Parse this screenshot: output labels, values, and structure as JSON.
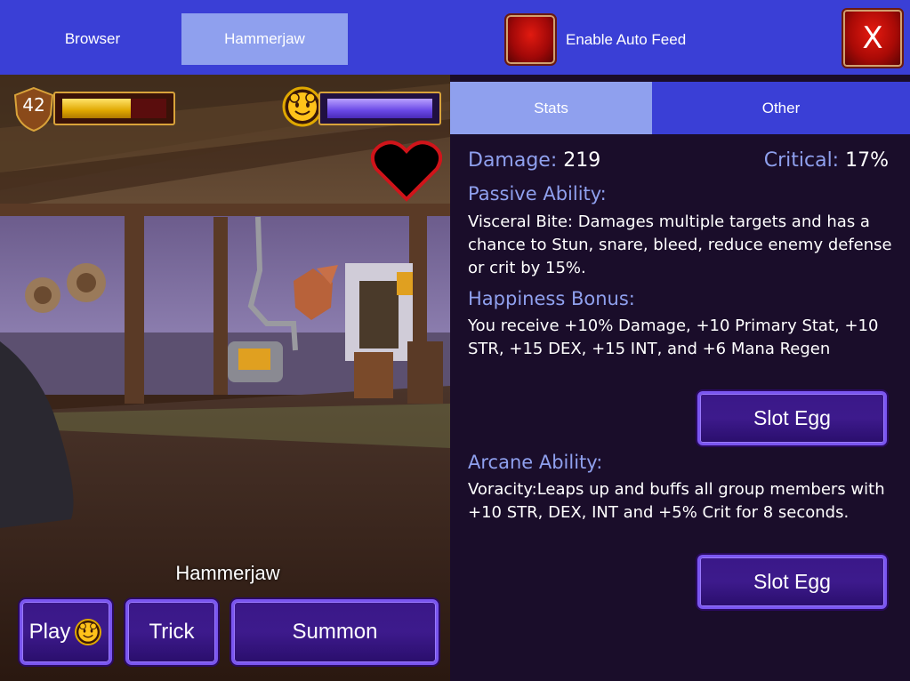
{
  "top_tabs": {
    "browser": "Browser",
    "pet": "Hammerjaw"
  },
  "auto_feed": {
    "label": "Enable Auto Feed",
    "checked": false
  },
  "close": {
    "label": "X"
  },
  "pet": {
    "level": "42",
    "xp_fraction": 0.66,
    "happiness_fraction": 1.0,
    "name": "Hammerjaw",
    "happiness_icon": "smiley-paw-icon",
    "heart_icon": "heart-icon"
  },
  "actions": {
    "play": "Play",
    "trick": "Trick",
    "summon": "Summon"
  },
  "panel_tabs": {
    "stats": "Stats",
    "other": "Other"
  },
  "stats": {
    "damage_label": "Damage:",
    "damage_value": "219",
    "critical_label": "Critical:",
    "critical_value": "17%"
  },
  "passive": {
    "heading": "Passive Ability:",
    "text": "Visceral Bite: Damages multiple targets and has a chance to Stun, snare, bleed, reduce enemy defense or crit by 15%."
  },
  "happiness_bonus": {
    "heading": "Happiness Bonus:",
    "text": "You receive +10% Damage, +10 Primary Stat, +10 STR, +15 DEX, +15 INT, and +6 Mana Regen"
  },
  "arcane": {
    "heading": "Arcane Ability:",
    "text": "Voracity:Leaps up and buffs all group members with +10 STR, DEX, INT and +5% Crit for 8 seconds."
  },
  "slot_buttons": {
    "first": "Slot Egg",
    "second": "Slot Egg"
  },
  "colors": {
    "top_bar": "#3a3fd6",
    "tab_active": "#8fa0ee",
    "panel_bg": "#1a0d2a",
    "heading": "#8fa0ee",
    "xp_fill": "#e0a800",
    "happiness_fill": "#6a48e6"
  }
}
